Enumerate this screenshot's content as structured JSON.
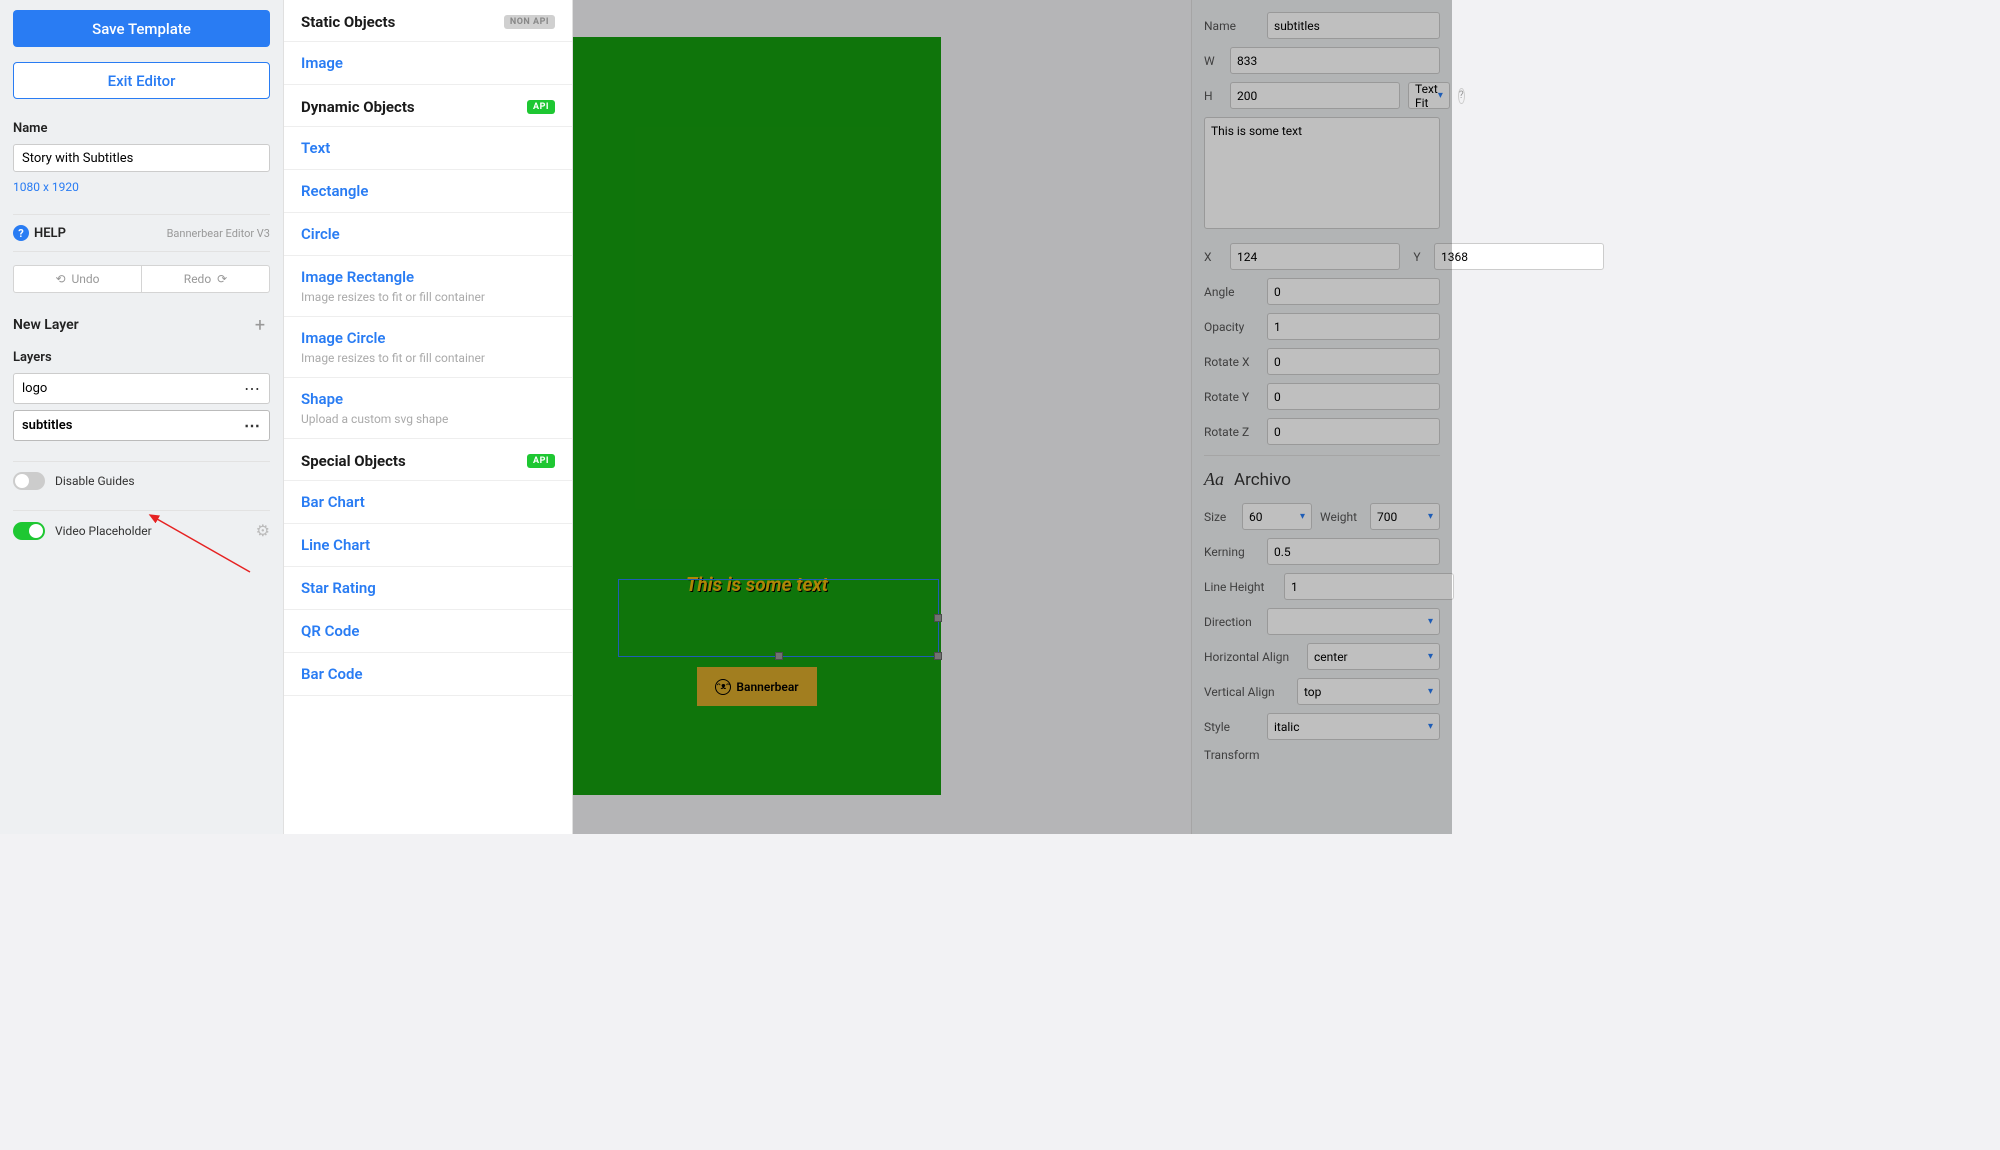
{
  "left": {
    "save": "Save Template",
    "exit": "Exit Editor",
    "name_label": "Name",
    "name_value": "Story with Subtitles",
    "dimensions": "1080 x 1920",
    "help": "HELP",
    "editor_version": "Bannerbear Editor V3",
    "undo": "Undo",
    "redo": "Redo",
    "new_layer": "New Layer",
    "layers_label": "Layers",
    "layers": [
      "logo",
      "subtitles"
    ],
    "disable_guides": "Disable Guides",
    "video_placeholder": "Video Placeholder"
  },
  "dropdown": {
    "groups": [
      {
        "title": "Static Objects",
        "badge": "NON API",
        "badge_type": "gray",
        "items": [
          {
            "t": "Image"
          }
        ]
      },
      {
        "title": "Dynamic Objects",
        "badge": "API",
        "badge_type": "green",
        "items": [
          {
            "t": "Text"
          },
          {
            "t": "Rectangle"
          },
          {
            "t": "Circle"
          },
          {
            "t": "Image Rectangle",
            "s": "Image resizes to fit or fill container"
          },
          {
            "t": "Image Circle",
            "s": "Image resizes to fit or fill container"
          },
          {
            "t": "Shape",
            "s": "Upload a custom svg shape"
          }
        ]
      },
      {
        "title": "Special Objects",
        "badge": "API",
        "badge_type": "green",
        "items": [
          {
            "t": "Bar Chart"
          },
          {
            "t": "Line Chart"
          },
          {
            "t": "Star Rating"
          },
          {
            "t": "QR Code"
          },
          {
            "t": "Bar Code"
          }
        ]
      }
    ]
  },
  "canvas": {
    "sub_text": "This is some text",
    "logo_text": "Bannerbear"
  },
  "props": {
    "name_l": "Name",
    "name_v": "subtitles",
    "w_l": "W",
    "w_v": "833",
    "h_l": "H",
    "h_v": "200",
    "textfit": "Text Fit",
    "textarea": "This is some text",
    "x_l": "X",
    "x_v": "124",
    "y_l": "Y",
    "y_v": "1368",
    "angle_l": "Angle",
    "angle_v": "0",
    "opacity_l": "Opacity",
    "opacity_v": "1",
    "rx_l": "Rotate X",
    "rx_v": "0",
    "ry_l": "Rotate Y",
    "ry_v": "0",
    "rz_l": "Rotate Z",
    "rz_v": "0",
    "font": "Archivo",
    "size_l": "Size",
    "size_v": "60",
    "weight_l": "Weight",
    "weight_v": "700",
    "kern_l": "Kerning",
    "kern_v": "0.5",
    "lh_l": "Line Height",
    "lh_v": "1",
    "dir_l": "Direction",
    "halign_l": "Horizontal Align",
    "halign_v": "center",
    "valign_l": "Vertical Align",
    "valign_v": "top",
    "style_l": "Style",
    "style_v": "italic",
    "transform_l": "Transform"
  }
}
